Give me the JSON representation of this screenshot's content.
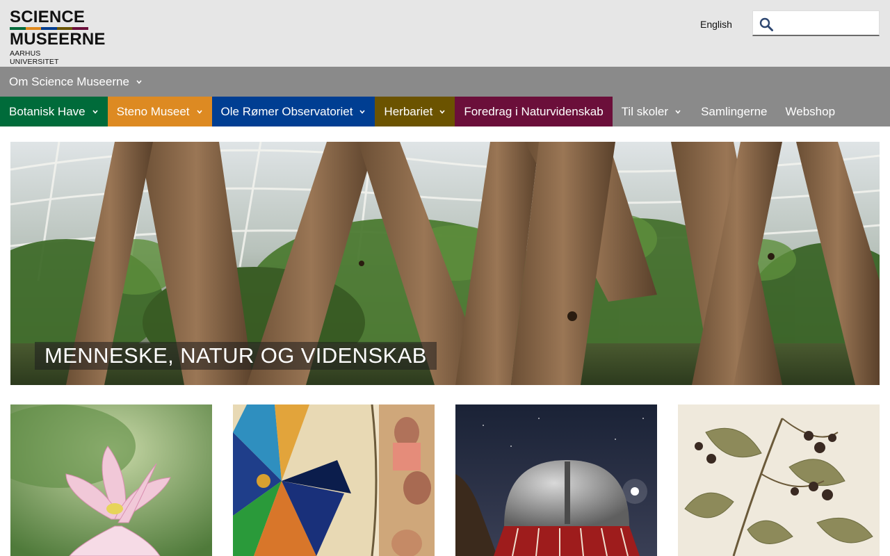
{
  "logo": {
    "line1": "SCIENCE",
    "line2": "MUSEERNE",
    "sub": "AARHUS UNIVERSITET",
    "stripe_colors": [
      "#006b3a",
      "#e08a1e",
      "#003d8f",
      "#6b5400",
      "#6b0e3a",
      "#8a8a8a"
    ]
  },
  "header": {
    "language_link": "English",
    "search": {
      "placeholder": "",
      "value": ""
    },
    "icons": {
      "search": "search-icon"
    }
  },
  "nav_primary": [
    {
      "label": "Om Science Museerne",
      "has_dropdown": true
    }
  ],
  "nav_secondary": [
    {
      "label": "Botanisk Have",
      "has_dropdown": true,
      "color": "#006b3a"
    },
    {
      "label": "Steno Museet",
      "has_dropdown": true,
      "color": "#dd8a22"
    },
    {
      "label": "Ole Rømer Observatoriet",
      "has_dropdown": true,
      "color": "#003e92"
    },
    {
      "label": "Herbariet",
      "has_dropdown": true,
      "color": "#6b5300"
    },
    {
      "label": "Foredrag i Naturvidenskab",
      "has_dropdown": false,
      "color": "#6b0f3a"
    },
    {
      "label": "Til skoler",
      "has_dropdown": true,
      "color": "#8a8a8a"
    },
    {
      "label": "Samlingerne",
      "has_dropdown": false,
      "color": "#8a8a8a"
    },
    {
      "label": "Webshop",
      "has_dropdown": false,
      "color": "#8a8a8a"
    }
  ],
  "hero": {
    "caption": "MENNESKE, NATUR OG VIDENSKAB"
  },
  "cards": [
    {
      "image": "lotus-flower-image"
    },
    {
      "image": "astronomical-clock-image"
    },
    {
      "image": "observatory-dome-image"
    },
    {
      "image": "herbarium-specimen-image"
    }
  ]
}
